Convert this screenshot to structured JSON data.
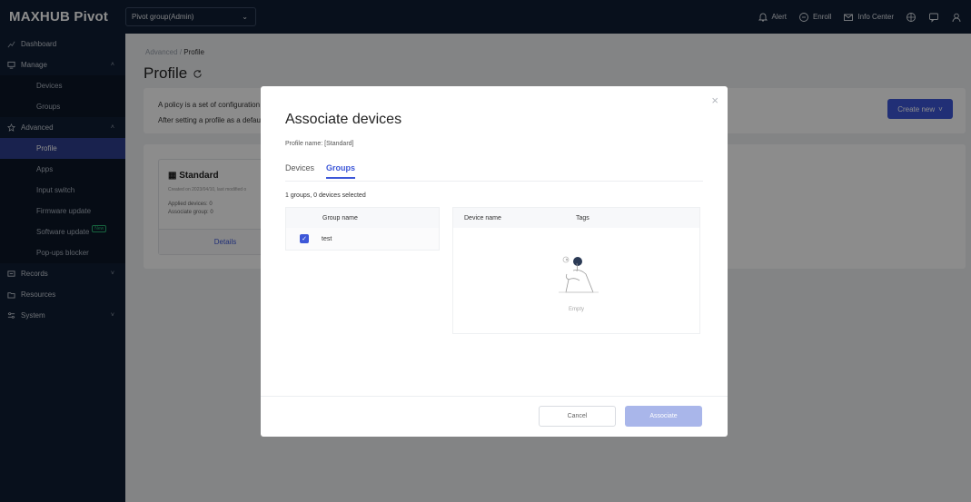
{
  "app": {
    "brand": "MAXHUB Pivot",
    "group_select": "Pivot group(Admin)"
  },
  "topbar": {
    "alert": "Alert",
    "enroll": "Enroll",
    "info_center": "Info Center"
  },
  "sidebar": {
    "items": [
      {
        "label": "Dashboard",
        "icon": "chart-icon"
      },
      {
        "label": "Manage",
        "icon": "monitor-icon"
      },
      {
        "label": "Devices"
      },
      {
        "label": "Groups"
      },
      {
        "label": "Advanced",
        "icon": "star-icon"
      },
      {
        "label": "Profile"
      },
      {
        "label": "Apps"
      },
      {
        "label": "Input switch"
      },
      {
        "label": "Firmware update"
      },
      {
        "label": "Software update",
        "badge": "New"
      },
      {
        "label": "Pop-ups blocker"
      },
      {
        "label": "Records",
        "icon": "records-icon"
      },
      {
        "label": "Resources",
        "icon": "resources-icon"
      },
      {
        "label": "System",
        "icon": "system-icon"
      }
    ]
  },
  "main": {
    "breadcrumb_parent": "Advanced",
    "breadcrumb_sep": "/",
    "breadcrumb_current": "Profile",
    "title": "Profile",
    "info_line1": "A policy is a set of configuration",
    "info_line2": "After setting a profile as a defau",
    "create_button": "Create new",
    "card": {
      "title": "Standard",
      "meta": "Created on 2023/04/10, last modified o",
      "applied": "Applied devices: 0",
      "group": "Associate group: 0",
      "details": "Details"
    }
  },
  "modal": {
    "title": "Associate devices",
    "profile_name": "Profile name: [Standard]",
    "tab_devices": "Devices",
    "tab_groups": "Groups",
    "selection": "1 groups, 0 devices selected",
    "left_header": "Group name",
    "left_rows": [
      {
        "name": "test",
        "checked": true
      }
    ],
    "right_header_device": "Device name",
    "right_header_tags": "Tags",
    "empty": "Empty",
    "cancel": "Cancel",
    "associate": "Associate"
  },
  "colors": {
    "primary": "#3d57d8",
    "sidebar_bg": "#0f1e33",
    "active_item": "#2f3f8f"
  }
}
